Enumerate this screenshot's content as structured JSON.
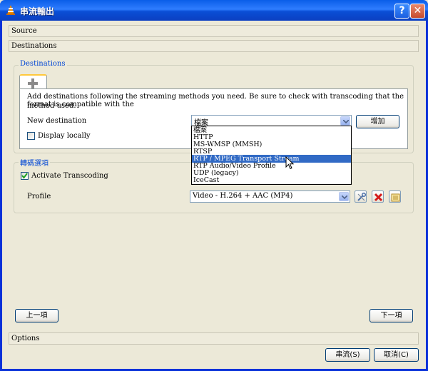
{
  "window": {
    "title": "串流輸出",
    "help_glyph": "?",
    "close_glyph": "✕"
  },
  "sections": {
    "source": "Source",
    "destinations": "Destinations",
    "options": "Options"
  },
  "destinations_group": {
    "title": "Destinations",
    "tab_icon": "plus-icon",
    "description": "Add destinations following the streaming methods you need. Be sure to check with transcoding that the format is compatible with the method used.",
    "description_line1": "Add destinations following the streaming methods you need. Be sure to check with transcoding that the format is compatible with the",
    "description_line2": "method used.",
    "new_destination_label": "New destination",
    "new_destination_value": "檔案",
    "add_button": "增加",
    "display_locally_label": "Display locally",
    "display_locally_checked": false,
    "dropdown_options": [
      "檔案",
      "HTTP",
      "MS-WMSP (MMSH)",
      "RTSP",
      "RTP / MPEG Transport Stream",
      "RTP Audio/Video Profile",
      "UDP (legacy)",
      "IceCast"
    ],
    "highlighted_option": "RTP / MPEG Transport Stream"
  },
  "transcoding_group": {
    "title": "轉碼選項",
    "activate_label": "Activate Transcoding",
    "activate_checked": true,
    "profile_label": "Profile",
    "profile_value": "Video - H.264 + AAC (MP4)",
    "profile_icons": [
      "wrench-icon",
      "delete-icon",
      "new-profile-icon"
    ]
  },
  "navigation": {
    "back_button": "上一項",
    "next_button": "下一項"
  },
  "footer": {
    "stream_button": "串流(S)",
    "cancel_button": "取消(C)"
  },
  "colors": {
    "titlebar": "#0a5ee8",
    "group_title": "#0046d5",
    "selection": "#316ac5",
    "dialog_bg": "#ece9d8"
  }
}
